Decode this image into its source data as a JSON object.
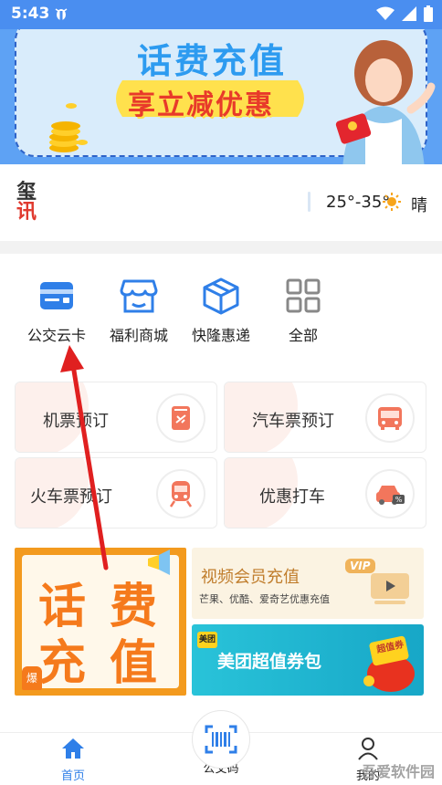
{
  "status_bar": {
    "time": "5:43"
  },
  "banner": {
    "title": "话费充值",
    "subtitle": "享立减优惠"
  },
  "weather": {
    "logo_top": "玺",
    "logo_bottom": "讯",
    "temperature": "25°-35°",
    "condition": "晴"
  },
  "services": [
    {
      "label": "公交云卡",
      "icon": "bus-card-icon"
    },
    {
      "label": "福利商城",
      "icon": "shop-icon"
    },
    {
      "label": "快隆惠递",
      "icon": "package-box-icon"
    },
    {
      "label": "全部",
      "icon": "grid-all-icon"
    }
  ],
  "bookings": [
    {
      "label": "机票预订",
      "icon": "plane-ticket-icon"
    },
    {
      "label": "汽车票预订",
      "icon": "bus-icon"
    },
    {
      "label": "火车票预订",
      "icon": "train-icon"
    },
    {
      "label": "优惠打车",
      "icon": "taxi-icon"
    }
  ],
  "promos": {
    "recharge": {
      "line1a": "话",
      "line1b": "费",
      "line2a": "充",
      "line2b": "值",
      "badge": "爆"
    },
    "vip": {
      "title": "视频会员充值",
      "subtitle": "芒果、优酷、爱奇艺优惠充值",
      "tag": "VIP"
    },
    "meituan": {
      "tag": "美团",
      "title": "美团超值券包",
      "coupon": "超值券"
    }
  },
  "bottom_nav": {
    "home": "首页",
    "qr": "公交码",
    "mine": "我的"
  },
  "watermark": {
    "text": "吾爱软件园"
  },
  "colors": {
    "primary": "#4a8ef0",
    "accent_orange": "#f57a1c",
    "arrow": "#e02020"
  }
}
